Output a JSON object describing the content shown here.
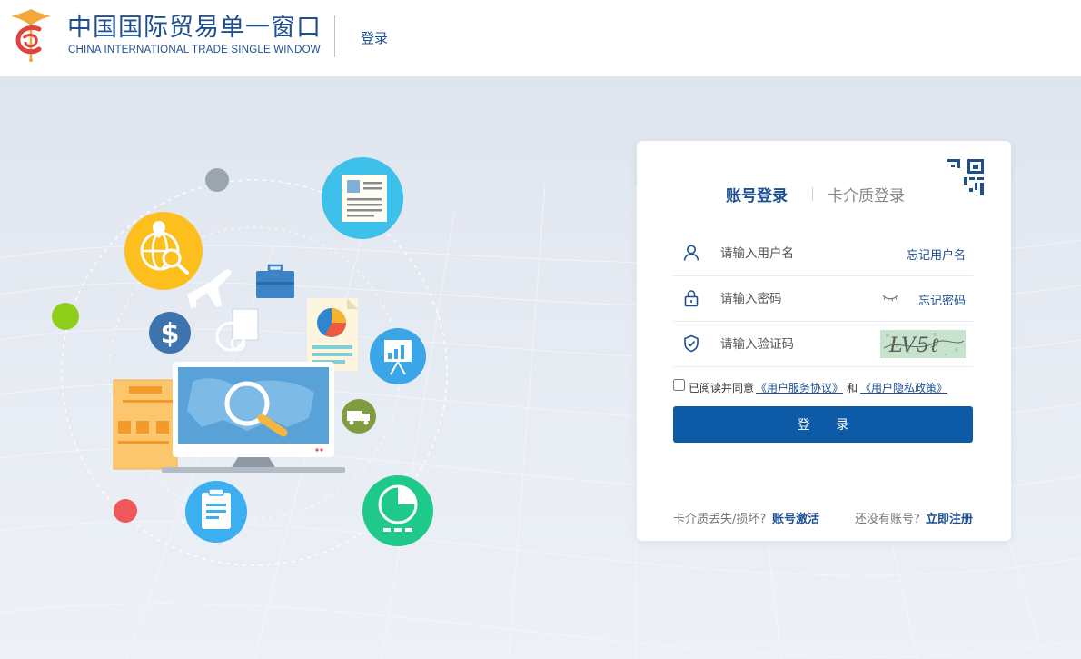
{
  "header": {
    "title_cn": "中国国际贸易单一窗口",
    "title_en": "CHINA INTERNATIONAL TRADE SINGLE WINDOW",
    "login_link": "登录"
  },
  "login_card": {
    "tabs": [
      {
        "label": "账号登录",
        "active": true
      },
      {
        "label": "卡介质登录",
        "active": false
      }
    ],
    "username": {
      "placeholder": "请输入用户名",
      "value": "",
      "link": "忘记用户名",
      "icon": "user-icon"
    },
    "password": {
      "placeholder": "请输入密码",
      "value": "",
      "link": "忘记密码",
      "icon": "lock-icon"
    },
    "captcha": {
      "placeholder": "请输入验证码",
      "value": "",
      "icon": "shield-check-icon",
      "image_text": "LV5ℓ"
    },
    "agreement": {
      "checked": false,
      "prefix": "已阅读并同意",
      "link1": "《用户服务协议》",
      "and": "和",
      "link2": "《用户隐私政策》"
    },
    "login_button": "登 录",
    "footer": {
      "lost_card_text": "卡介质丢失/损坏?",
      "lost_card_link": "账号激活",
      "no_account_text": "还没有账号?",
      "register_link": "立即注册"
    }
  },
  "colors": {
    "brand_blue": "#1d4f91",
    "button_blue": "#0d5aa7",
    "background": "#e4eaf3"
  }
}
